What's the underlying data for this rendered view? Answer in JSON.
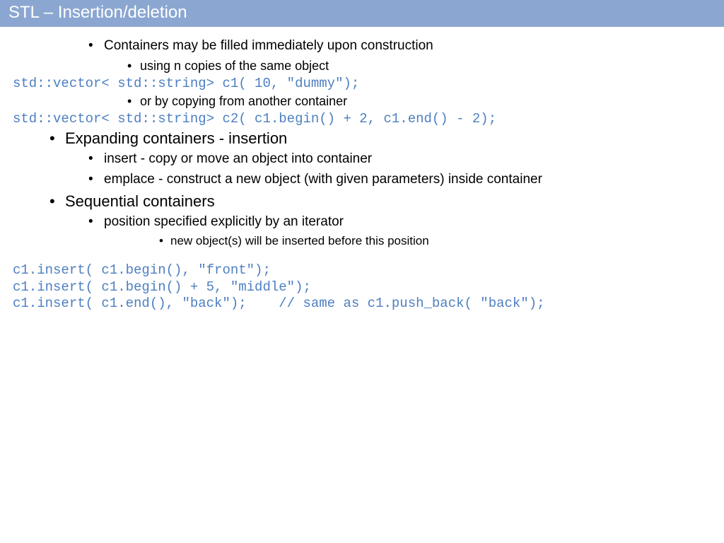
{
  "title": "STL – Insertion/deletion",
  "b1": "Containers may be filled immediately upon construction",
  "b1a": "using n copies of the same object",
  "code1": "std::vector< std::string> c1( 10, \"dummy\");",
  "b1b": "or by copying from another container",
  "code2": "std::vector< std::string> c2( c1.begin() + 2, c1.end() - 2);",
  "b2": "Expanding containers - insertion",
  "b2a": "insert - copy or move an object into container",
  "b2b": "emplace - construct a new object (with given parameters) inside container",
  "b3": "Sequential containers",
  "b3a": "position specified explicitly by an iterator",
  "b3a1": "new object(s) will be inserted before this position",
  "code3": "c1.insert( c1.begin(), \"front\");\nc1.insert( c1.begin() + 5, \"middle\");\nc1.insert( c1.end(), \"back\");    // same as c1.push_back( \"back\");"
}
